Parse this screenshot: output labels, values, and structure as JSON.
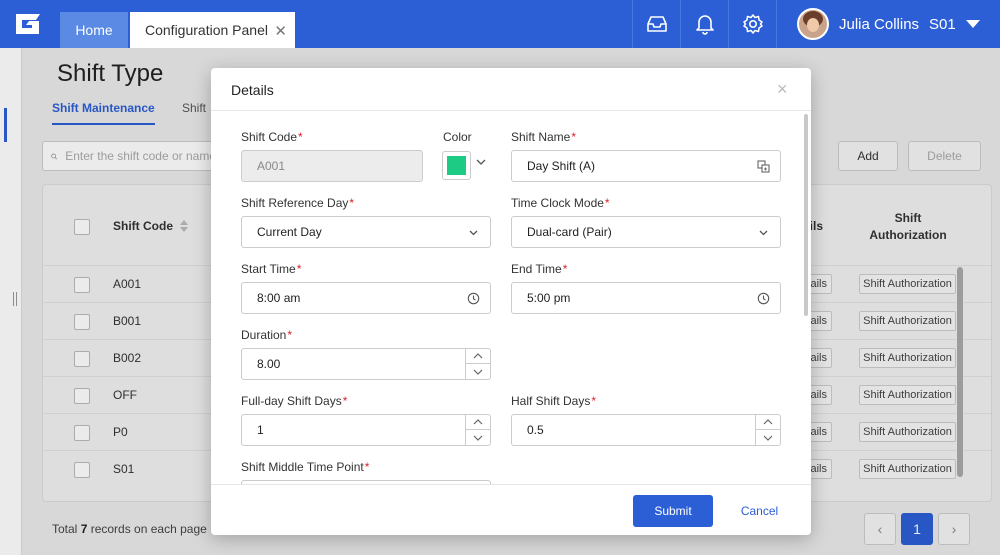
{
  "topbar": {
    "tabs": [
      {
        "label": "Home"
      },
      {
        "label": "Configuration Panel"
      }
    ],
    "user": {
      "name": "Julia Collins",
      "site": "S01"
    },
    "colors": {
      "primary": "#2c5fd6",
      "home_tab": "#5a8ae4"
    }
  },
  "page": {
    "title": "Shift Type",
    "tabs": [
      "Shift Maintenance",
      "Shift"
    ],
    "search_placeholder": "Enter the shift code or name",
    "add_label": "Add",
    "delete_label": "Delete",
    "columns": {
      "shift_code": "Shift Code",
      "details": "ails",
      "shift_authorization_1": "Shift",
      "shift_authorization_2": "Authorization"
    },
    "rows": [
      {
        "code": "A001",
        "details": "ails",
        "auth": "Shift Authorization"
      },
      {
        "code": "B001",
        "details": "ails",
        "auth": "Shift Authorization"
      },
      {
        "code": "B002",
        "details": "ails",
        "auth": "Shift Authorization"
      },
      {
        "code": "OFF",
        "details": "ails",
        "auth": "Shift Authorization"
      },
      {
        "code": "P0",
        "details": "ails",
        "auth": "Shift Authorization"
      },
      {
        "code": "S01",
        "details": "ails",
        "auth": "Shift Authorization"
      }
    ],
    "footer": {
      "prefix": "Total ",
      "count": "7",
      "suffix": " records on each page"
    },
    "pager": {
      "current": "1",
      "prev": "‹",
      "next": "›"
    }
  },
  "modal": {
    "title": "Details",
    "close": "×",
    "fields": {
      "shift_code": {
        "label": "Shift Code",
        "value": "A001"
      },
      "color": {
        "label": "Color",
        "value": "#1ecb84"
      },
      "shift_name": {
        "label": "Shift Name",
        "value": "Day Shift (A)"
      },
      "ref_day": {
        "label": "Shift Reference Day",
        "value": "Current Day"
      },
      "clock_mode": {
        "label": "Time Clock Mode",
        "value": "Dual-card (Pair)"
      },
      "start_time": {
        "label": "Start Time",
        "value": "8:00 am"
      },
      "end_time": {
        "label": "End Time",
        "value": "5:00 pm"
      },
      "duration": {
        "label": "Duration",
        "value": "8.00"
      },
      "full_day": {
        "label": "Full-day Shift Days",
        "value": "1"
      },
      "half_day": {
        "label": "Half Shift Days",
        "value": "0.5"
      },
      "middle_point": {
        "label": "Shift Middle Time Point"
      }
    },
    "required_mark": "*",
    "submit_label": "Submit",
    "cancel_label": "Cancel"
  }
}
